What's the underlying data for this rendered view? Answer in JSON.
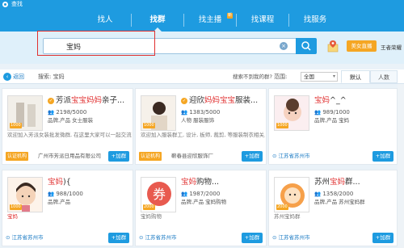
{
  "window": {
    "title": "查找"
  },
  "nav": {
    "tabs": [
      {
        "label": "找人"
      },
      {
        "label": "找群"
      },
      {
        "label": "找主播",
        "badge": "新"
      },
      {
        "label": "找课程"
      },
      {
        "label": "找服务"
      }
    ]
  },
  "search": {
    "value": "宝妈"
  },
  "live_button": "美女直播",
  "side_text": "王者荣耀",
  "filter": {
    "back": "返回",
    "search_label": "搜索:",
    "keyword": "宝妈",
    "not_found": "搜索不到我的群?",
    "range_label": "范围:",
    "range_value": "全国",
    "sort_default": "默认",
    "sort_people": "人数"
  },
  "cards": [
    {
      "title_pre": "芳派",
      "title_hl": "宝宝妈妈",
      "title_post": "亲子...",
      "verified": "✓",
      "count": "2198/5000",
      "tags": "品牌,产品    女士服装",
      "desc": "欢迎加入芳派女装批发微群, 在这里大家可以一起交流女装批发的经验, 女装的设计, 创意...",
      "cert": "认证机构",
      "org": "广州市芳派日用品有限公司",
      "location": "",
      "join": "+加群"
    },
    {
      "title_pre": "迎欣",
      "title_hl": "妈妈宝宝",
      "title_post": "服装...",
      "verified": "✓",
      "count": "1383/5000",
      "tags": "人物    服装服饰",
      "desc": "欢迎加入服装群工, 设计, 板师, 裁剪, 等服装制衣相关人员加入服装群, 非服装行业勿扰!",
      "cert": "认证机构",
      "org": "蕲春县迎欣服饰厂",
      "location": "",
      "join": "+加群"
    },
    {
      "title_pre": "",
      "title_hl": "宝妈",
      "title_post": "^_^",
      "verified": "",
      "count": "989/1000",
      "tags": "品牌,产品    宝妈",
      "desc": "",
      "cert": "",
      "org": "",
      "location": "江苏省苏州市",
      "join": "+加群"
    },
    {
      "title_pre": "",
      "title_hl": "宝妈",
      "title_post": "){",
      "verified": "",
      "count": "988/1000",
      "tags": "品牌,产品",
      "desc": "宝妈",
      "cert": "",
      "org": "",
      "location": "江苏省苏州市",
      "join": "+加群"
    },
    {
      "title_pre": "",
      "title_hl": "宝妈",
      "title_post": "购物...",
      "verified": "",
      "count": "1987/2000",
      "tags": "品牌,产品    宝妈购物",
      "desc": "宝妈购物",
      "cert": "",
      "org": "",
      "location": "江苏省苏州市",
      "join": "+加群"
    },
    {
      "title_pre": "苏州",
      "title_hl": "宝妈",
      "title_post": "群...",
      "verified": "",
      "count": "1358/2000",
      "tags": "品牌,产品    苏州宝妈群",
      "desc": "苏州宝妈群",
      "cert": "",
      "org": "",
      "location": "江苏省苏州市",
      "join": "+加群"
    }
  ],
  "avatar_levels": [
    "1000",
    "1000",
    "1000",
    "1000",
    "2000",
    "2000"
  ],
  "colors": {
    "brand": "#1e9be0",
    "highlight": "#e03030",
    "accent": "#f5a623"
  }
}
